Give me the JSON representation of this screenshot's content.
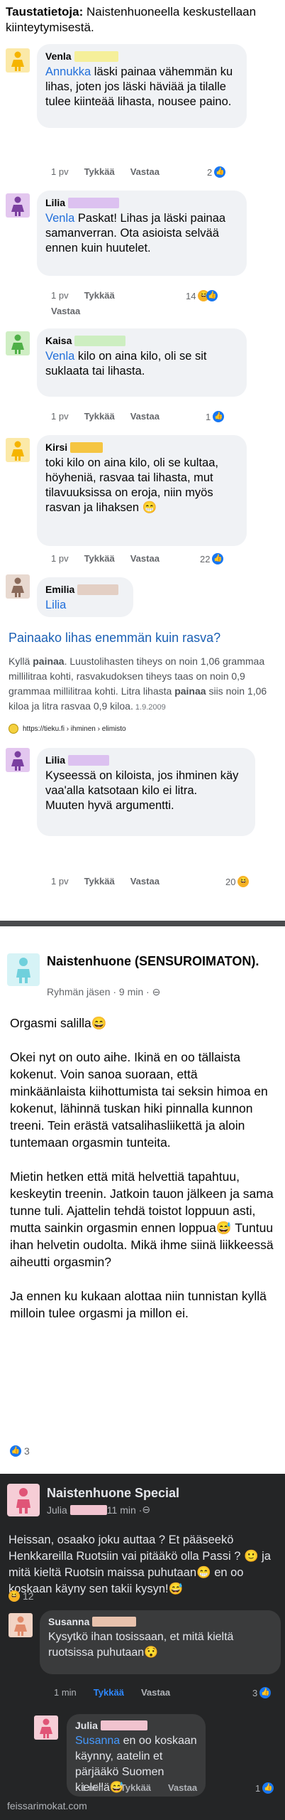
{
  "intro": {
    "label": "Taustatietoja:",
    "text": " Naistenhuoneella keskustellaan kiinteytymisestä."
  },
  "colors": {
    "yellow": "#f5c542",
    "purple": "#7b3fa0",
    "green": "#4fb048",
    "brown": "#8a6a5a",
    "pink": "#e05577",
    "cyan": "#6fd0dc",
    "like": "#1877f2",
    "link": "#216fdb"
  },
  "comments": [
    {
      "name": "Venla",
      "mention": "Annukka",
      "text": " läski painaa vähemmän ku lihas, joten jos läski häviää ja tilalle tulee kiinteää lihasta, nousee paino.",
      "time": "1 pv",
      "like": "Tykkää",
      "reply": "Vastaa",
      "count": "2"
    },
    {
      "name": "Lilia",
      "mention": "Venla",
      "text": " Paskat! Lihas ja läski painaa samanverran. Ota asioista selvää ennen kuin huutelet.",
      "time": "1 pv",
      "like": "Tykkää",
      "reply": "Vastaa",
      "count": "14"
    },
    {
      "name": "Kaisa",
      "mention": "Venla",
      "text": " kilo on aina kilo, oli se sit suklaata tai lihasta.",
      "time": "1 pv",
      "like": "Tykkää",
      "reply": "Vastaa",
      "count": "1"
    },
    {
      "name": "Kirsi",
      "mention": "",
      "text": "toki kilo on aina kilo, oli se kultaa, höyheniä, rasvaa tai lihasta, mut tilavuuksissa on eroja, niin myös rasvan ja lihaksen",
      "time": "1 pv",
      "like": "Tykkää",
      "reply": "Vastaa",
      "count": "22"
    },
    {
      "name": "Emilia",
      "mention": "Lilia",
      "text": ""
    }
  ],
  "link": {
    "question": "Painaako lihas enemmän kuin rasva?",
    "snippet_a": "Kyllä ",
    "snippet_b": "painaa",
    "snippet_c": ". Luustolihasten tiheys on noin 1,06 grammaa millilitraa kohti, rasvakudoksen tiheys taas on noin 0,9 grammaa millilitraa kohti. Litra lihasta ",
    "snippet_d": "painaa",
    "snippet_e": " siis noin 1,06 kiloa ja litra rasvaa 0,9 kiloa.",
    "date": " 1.9.2009",
    "source": "https://tieku.fi › ihminen › elimisto"
  },
  "lilia2": {
    "name": "Lilia",
    "text": "Kyseessä on kiloista, jos ihminen käy vaa'alla katsotaan kilo ei litra.\nMuuten hyvä argumentti.",
    "time": "1 pv",
    "like": "Tykkää",
    "reply": "Vastaa",
    "count": "20"
  },
  "post2": {
    "group": "Naistenhuone (SENSUROIMATON).",
    "sub": "Ryhmän jäsen · 9 min · ",
    "p1": "Orgasmi salilla",
    "p2": "Okei nyt on outo aihe. Ikinä en oo tällaista kokenut. Voin sanoa suoraan, että minkäänlaista kiihottumista tai seksin himoa en kokenut, lähinnä tuskan hiki pinnalla kunnon treeni. Tein erästä vatsalihasliikettä ja aloin tuntemaan orgasmin tunteita.",
    "p3a": "Mietin hetken että mitä helvettiä tapahtuu, keskeytin treenin. Jatkoin tauon jälkeen ja sama tunne tuli. Ajattelin tehdä toistot loppuun asti, mutta sainkin orgasmin ennen loppua",
    "p3b": " Tuntuu ihan helvetin oudolta. Mikä ihme siinä liikkeessä aiheutti orgasmin?",
    "p4": "Ja ennen ku kukaan alottaa niin tunnistan kyllä milloin tulee orgasmi ja millon ei.",
    "likes": "3"
  },
  "post3": {
    "group": "Naistenhuone Special",
    "author": "Julia",
    "time": " 11 min · ",
    "text_a": "Heissan, osaako joku auttaa ? Et pääseekö Henkkareilla Ruotsiin vai pitääkö olla Passi ? ",
    "text_b": " ja mitä kieltä Ruotsin maissa puhutaan",
    "text_c": " en oo koskaan käyny sen takii kysyn!",
    "reactions": "12",
    "c1_name": "Susanna",
    "c1_text": "Kysytkö ihan tosissaan, et mitä kieltä ruotsissa puhutaan",
    "c1_time": "1 min",
    "c1_like": "Tykkää",
    "c1_reply": "Vastaa",
    "c1_count": "3",
    "c2_name": "Julia",
    "c2_mention": "Susanna",
    "c2_text": " en oo koskaan käynny, aatelin et pärjääkö Suomen kielellä",
    "c2_time": "1 min",
    "c2_like": "Tykkää",
    "c2_reply": "Vastaa",
    "c2_count": "1"
  },
  "watermark": "feissarimokat.com"
}
